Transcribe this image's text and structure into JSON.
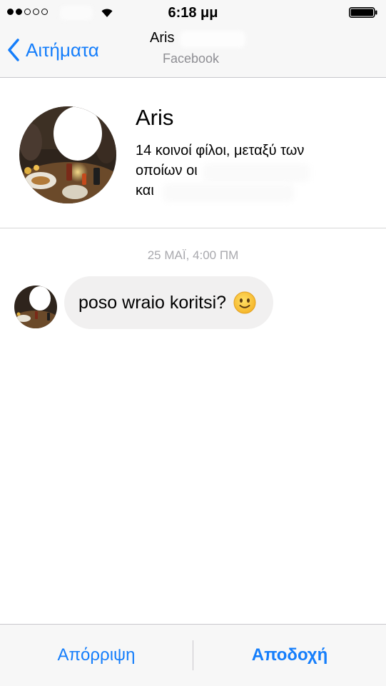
{
  "status_bar": {
    "time": "6:18 μμ",
    "signal_bars_filled": 2,
    "signal_bars_total": 5,
    "battery_level": 1.0
  },
  "nav": {
    "back_label": "Αιτήματα",
    "title": "Aris",
    "subtitle": "Facebook",
    "accent_color": "#157efb"
  },
  "profile": {
    "name": "Aris",
    "mutual_line1": "14 κοινοί φίλοι, μεταξύ των",
    "mutual_line2": "οποίων οι",
    "mutual_line3": "και"
  },
  "conversation": {
    "timestamp": "25 ΜΑΪ, 4:00 ΠΜ",
    "messages": [
      {
        "text": "poso wraio koritsi?",
        "emoji": "slightly-smiling-face"
      }
    ]
  },
  "actions": {
    "decline_label": "Απόρριψη",
    "accept_label": "Αποδοχή"
  },
  "icons": {
    "back": "chevron-left-icon",
    "wifi": "wifi-icon",
    "battery": "battery-icon"
  }
}
